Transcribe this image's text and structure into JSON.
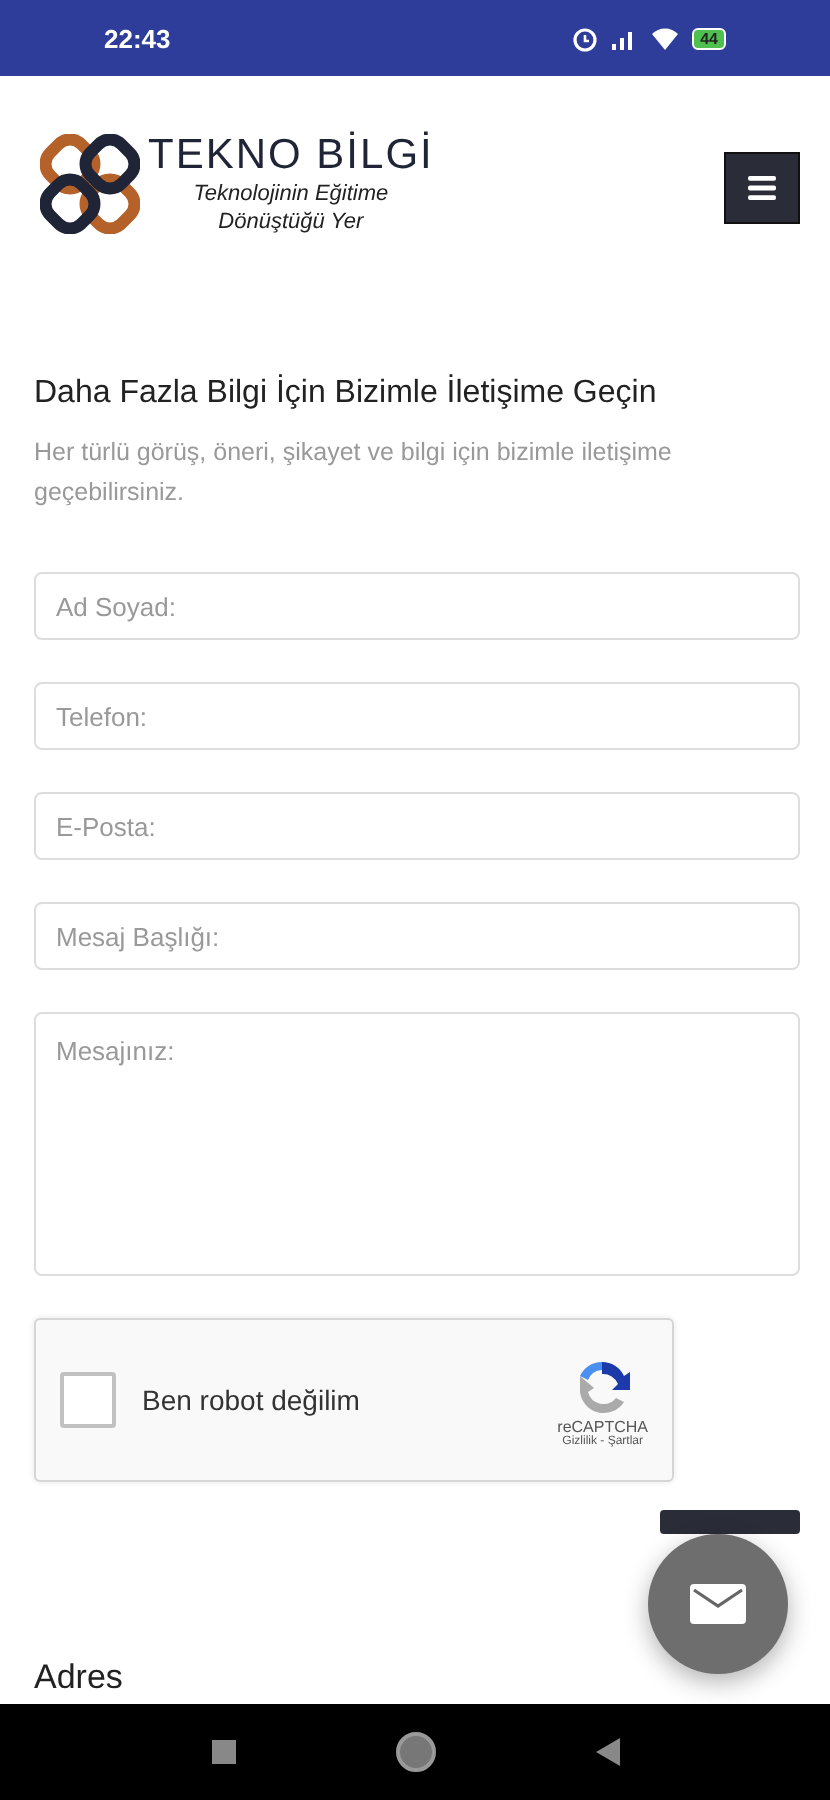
{
  "status_bar": {
    "time": "22:43",
    "battery": "44"
  },
  "header": {
    "brand": "TEKNO BİLGİ",
    "tagline": "Teknolojinin Eğitime Dönüştüğü Yer"
  },
  "contact": {
    "title": "Daha Fazla Bilgi İçin Bizimle İletişime Geçin",
    "subtitle": "Her türlü görüş, öneri, şikayet ve bilgi için bizimle iletişime geçebilirsiniz.",
    "fields": [
      {
        "kind": "input",
        "placeholder": "Ad Soyad:"
      },
      {
        "kind": "input",
        "placeholder": "Telefon:"
      },
      {
        "kind": "input",
        "placeholder": "E-Posta:"
      },
      {
        "kind": "input",
        "placeholder": "Mesaj Başlığı:"
      },
      {
        "kind": "textarea",
        "placeholder": "Mesajınız:"
      }
    ],
    "captcha": {
      "label": "Ben robot değilim",
      "checked": false,
      "brand": "reCAPTCHA",
      "links": "Gizlilik - Şartlar"
    }
  },
  "address_heading": "Adres"
}
